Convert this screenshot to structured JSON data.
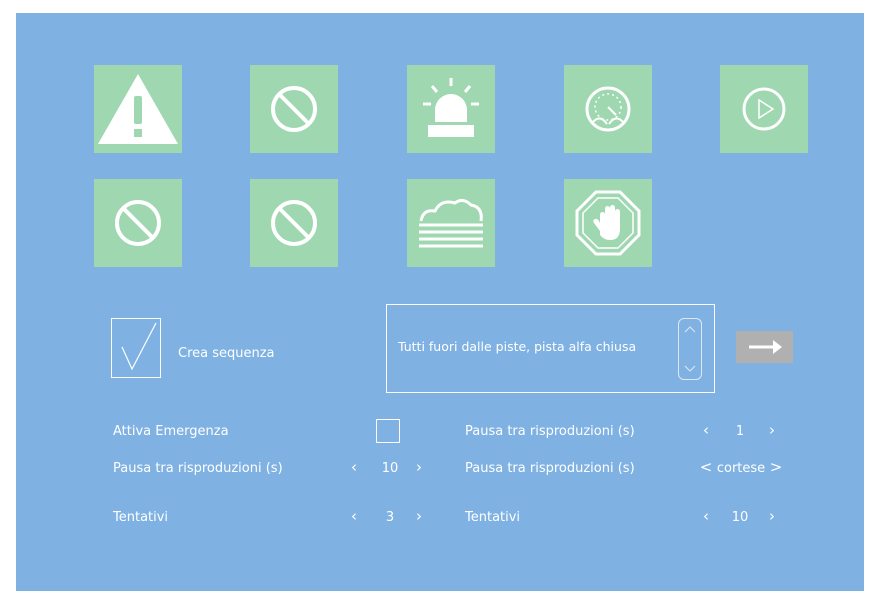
{
  "colors": {
    "background": "#7fb2e3",
    "tile": "#9ed7b0",
    "text": "#ffffff",
    "button": "#b0b0b0"
  },
  "tiles": [
    {
      "icon": "warning-icon"
    },
    {
      "icon": "prohibited-icon"
    },
    {
      "icon": "siren-icon"
    },
    {
      "icon": "gauge-icon"
    },
    {
      "icon": "play-icon"
    },
    {
      "icon": "prohibited-icon"
    },
    {
      "icon": "prohibited-icon"
    },
    {
      "icon": "fog-icon"
    },
    {
      "icon": "stop-hand-icon"
    }
  ],
  "sequence": {
    "label": "Crea sequenza",
    "checked": true
  },
  "message": {
    "text": "Tutti fuori dalle piste, pista alfa chiusa"
  },
  "settings_left": {
    "emergency_label": "Attiva Emergenza",
    "pause_label": "Pausa tra risproduzioni (s)",
    "pause_value": "10",
    "attempts_label": "Tentativi",
    "attempts_value": "3"
  },
  "settings_right": {
    "pause1_label": "Pausa tra risproduzioni (s)",
    "pause1_value": "1",
    "pause2_label": "Pausa tra risproduzioni (s)",
    "pause2_value": "cortese",
    "attempts_label": "Tentativi",
    "attempts_value": "10"
  },
  "chevrons": {
    "left": "‹",
    "right": "›",
    "left_lt": "<",
    "right_gt": ">"
  }
}
